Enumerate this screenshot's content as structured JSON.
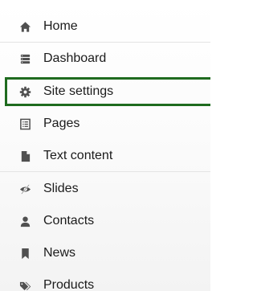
{
  "nav": {
    "items": [
      {
        "label": "Home",
        "icon": "home-icon"
      },
      {
        "label": "Dashboard",
        "icon": "dashboard-icon"
      },
      {
        "label": "Site settings",
        "icon": "gear-icon"
      },
      {
        "label": "Pages",
        "icon": "pages-icon"
      },
      {
        "label": "Text content",
        "icon": "file-icon"
      },
      {
        "label": "Slides",
        "icon": "slides-icon"
      },
      {
        "label": "Contacts",
        "icon": "user-icon"
      },
      {
        "label": "News",
        "icon": "bookmark-icon"
      },
      {
        "label": "Products",
        "icon": "tag-icon"
      }
    ],
    "selected_label": "Site settings",
    "highlight_color": "#1f6b1f",
    "icon_color": "#505050"
  }
}
